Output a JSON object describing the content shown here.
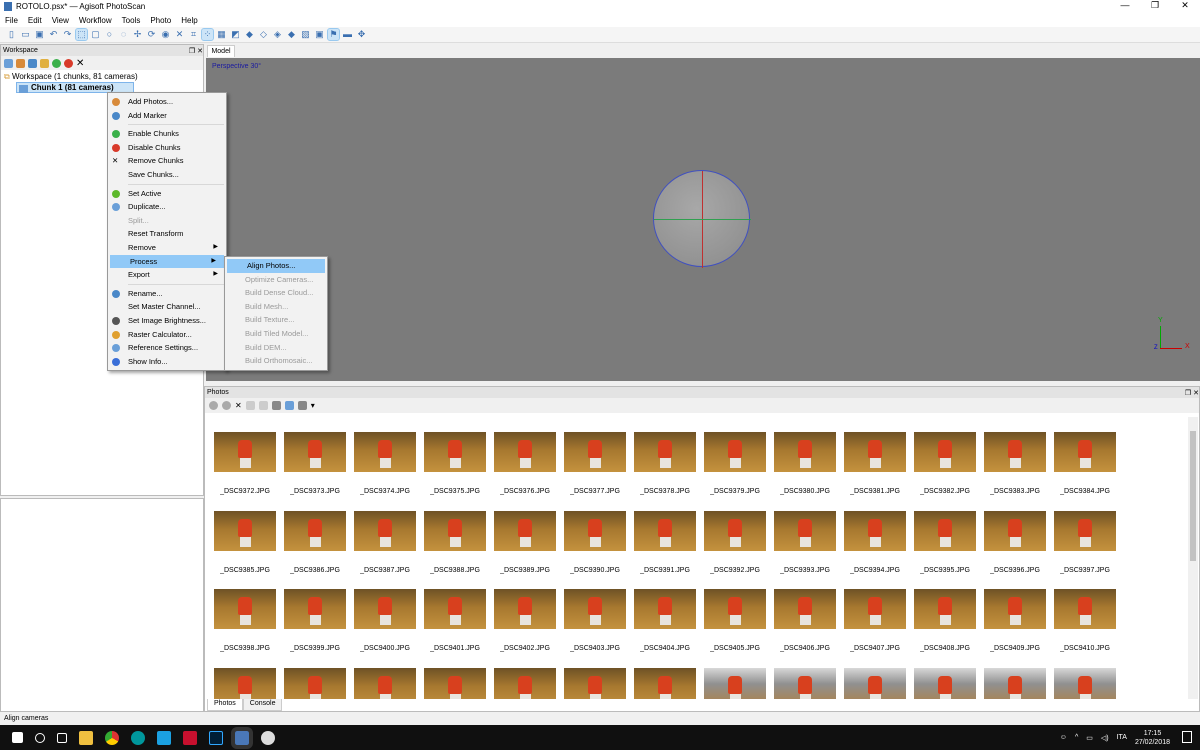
{
  "window": {
    "title": "ROTOLO.psx* — Agisoft PhotoScan",
    "minimize": "—",
    "maximize": "❐",
    "close": "✕"
  },
  "menubar": [
    "File",
    "Edit",
    "View",
    "Workflow",
    "Tools",
    "Photo",
    "Help"
  ],
  "workspace": {
    "title": "Workspace",
    "root": "Workspace (1 chunks, 81 cameras)",
    "chunk": "Chunk 1 (81 cameras)"
  },
  "context_menu": [
    {
      "label": "Add Photos...",
      "icon": "add-photos"
    },
    {
      "label": "Add Marker",
      "icon": "marker"
    },
    "sep",
    {
      "label": "Enable Chunks",
      "icon": "enable"
    },
    {
      "label": "Disable Chunks",
      "icon": "disable"
    },
    {
      "label": "Remove Chunks",
      "icon": "remove"
    },
    {
      "label": "Save Chunks..."
    },
    "sep",
    {
      "label": "Set Active",
      "icon": "check"
    },
    {
      "label": "Duplicate...",
      "icon": "duplicate"
    },
    {
      "label": "Split...",
      "disabled": true
    },
    {
      "label": "Reset Transform"
    },
    {
      "label": "Remove",
      "submenu": true
    },
    {
      "label": "Process",
      "submenu": true,
      "highlight": true
    },
    {
      "label": "Export",
      "submenu": true
    },
    "sep",
    {
      "label": "Rename...",
      "icon": "rename"
    },
    {
      "label": "Set Master Channel..."
    },
    {
      "label": "Set Image Brightness...",
      "icon": "brightness"
    },
    {
      "label": "Raster Calculator...",
      "icon": "calculator"
    },
    {
      "label": "Reference Settings...",
      "icon": "settings"
    },
    {
      "label": "Show Info...",
      "icon": "info"
    }
  ],
  "process_submenu": [
    {
      "label": "Align Photos...",
      "highlight": true
    },
    {
      "label": "Optimize Cameras...",
      "disabled": true
    },
    {
      "label": "Build Dense Cloud...",
      "disabled": true
    },
    {
      "label": "Build Mesh...",
      "disabled": true
    },
    {
      "label": "Build Texture...",
      "disabled": true
    },
    {
      "label": "Build Tiled Model...",
      "disabled": true
    },
    {
      "label": "Build DEM...",
      "disabled": true
    },
    {
      "label": "Build Orthomosaic...",
      "disabled": true
    }
  ],
  "model": {
    "tab": "Model",
    "view_label": "Perspective 30°",
    "axis_y": "Y",
    "axis_x": "X",
    "axis_z": "Z"
  },
  "photos": {
    "title": "Photos",
    "tabs": [
      "Photos",
      "Console"
    ],
    "files": [
      "_DSC9372.JPG",
      "_DSC9373.JPG",
      "_DSC9374.JPG",
      "_DSC9375.JPG",
      "_DSC9376.JPG",
      "_DSC9377.JPG",
      "_DSC9378.JPG",
      "_DSC9379.JPG",
      "_DSC9380.JPG",
      "_DSC9381.JPG",
      "_DSC9382.JPG",
      "_DSC9383.JPG",
      "_DSC9384.JPG",
      "_DSC9385.JPG",
      "_DSC9386.JPG",
      "_DSC9387.JPG",
      "_DSC9388.JPG",
      "_DSC9389.JPG",
      "_DSC9390.JPG",
      "_DSC9391.JPG",
      "_DSC9392.JPG",
      "_DSC9393.JPG",
      "_DSC9394.JPG",
      "_DSC9395.JPG",
      "_DSC9396.JPG",
      "_DSC9397.JPG",
      "_DSC9398.JPG",
      "_DSC9399.JPG",
      "_DSC9400.JPG",
      "_DSC9401.JPG",
      "_DSC9402.JPG",
      "_DSC9403.JPG",
      "_DSC9404.JPG",
      "_DSC9405.JPG",
      "_DSC9406.JPG",
      "_DSC9407.JPG",
      "_DSC9408.JPG",
      "_DSC9409.JPG",
      "_DSC9410.JPG"
    ],
    "partial_row_count": 13
  },
  "status": "Align cameras",
  "taskbar": {
    "lang": "ITA",
    "time": "17:15",
    "date": "27/02/2018"
  },
  "colors": {
    "accent": "#91c9f7",
    "viewport": "#7b7b7b",
    "taskbar": "#101010"
  }
}
